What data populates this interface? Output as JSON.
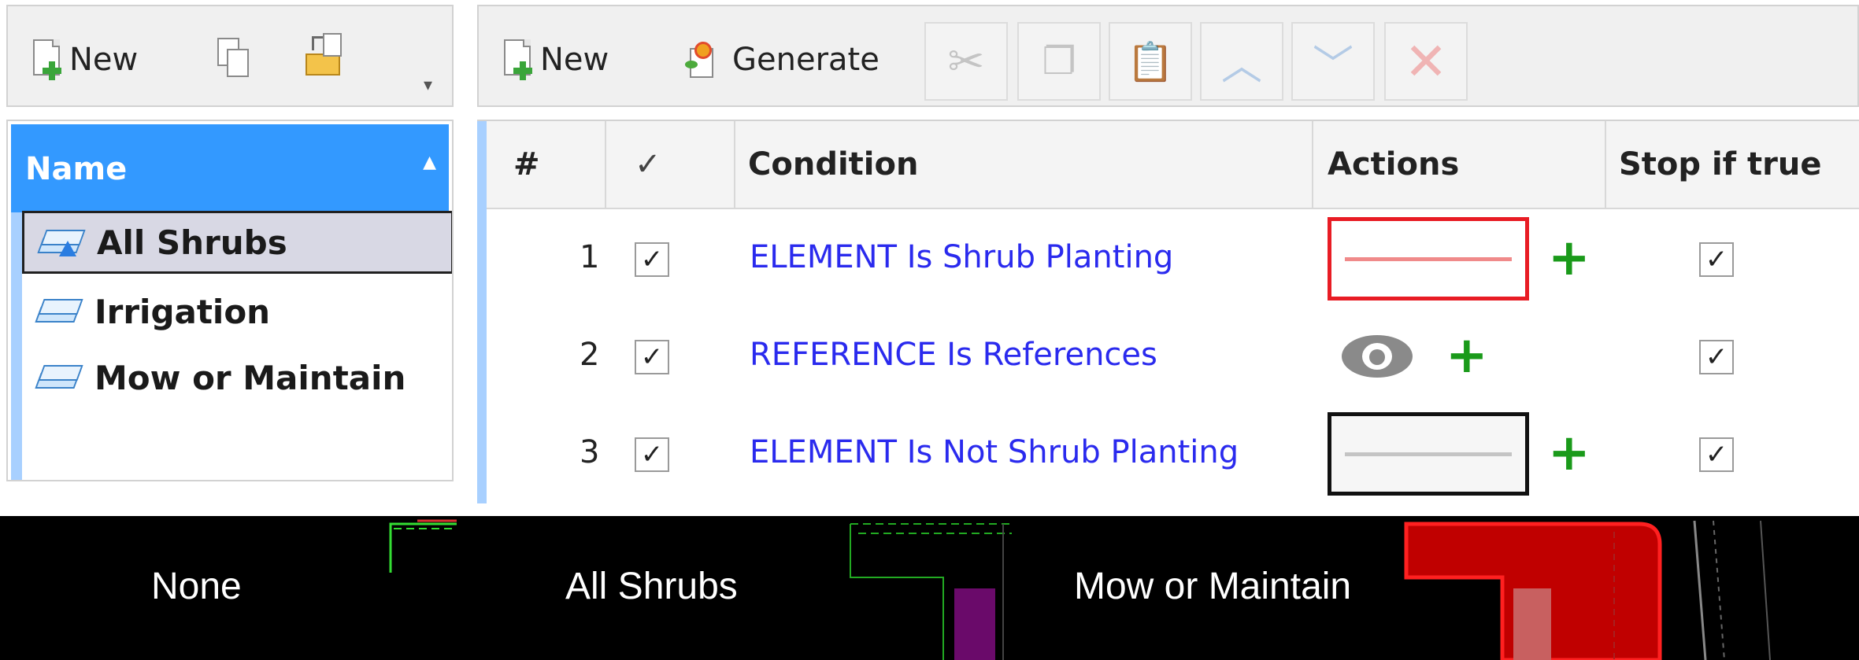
{
  "left_toolbar": {
    "new_label": "New"
  },
  "right_toolbar": {
    "new_label": "New",
    "generate_label": "Generate"
  },
  "list": {
    "header": "Name",
    "items": [
      {
        "label": "All Shrubs",
        "selected": true,
        "icon": "layer-warning-icon"
      },
      {
        "label": "Irrigation",
        "selected": false,
        "icon": "layer-icon"
      },
      {
        "label": "Mow or Maintain",
        "selected": false,
        "icon": "layer-icon"
      }
    ]
  },
  "grid": {
    "columns": [
      "#",
      "✓",
      "Condition",
      "Actions",
      "Stop if true"
    ],
    "rows": [
      {
        "num": "1",
        "enabled": true,
        "condition": "ELEMENT Is Shrub Planting",
        "action": "red-line-swatch",
        "stop_if_true": true
      },
      {
        "num": "2",
        "enabled": true,
        "condition": "REFERENCE Is References",
        "action": "eye-icon",
        "stop_if_true": true
      },
      {
        "num": "3",
        "enabled": true,
        "condition": "ELEMENT Is Not Shrub Planting",
        "action": "gray-line-swatch",
        "stop_if_true": true
      }
    ]
  },
  "preview": {
    "labels": [
      "None",
      "All Shrubs",
      "Mow or Maintain"
    ]
  },
  "colors": {
    "accent": "#3399ff",
    "condition_link": "#2a2aee",
    "plus": "#1a9a1a",
    "red_swatch": "#e81c24",
    "preview_red": "#c00000"
  }
}
